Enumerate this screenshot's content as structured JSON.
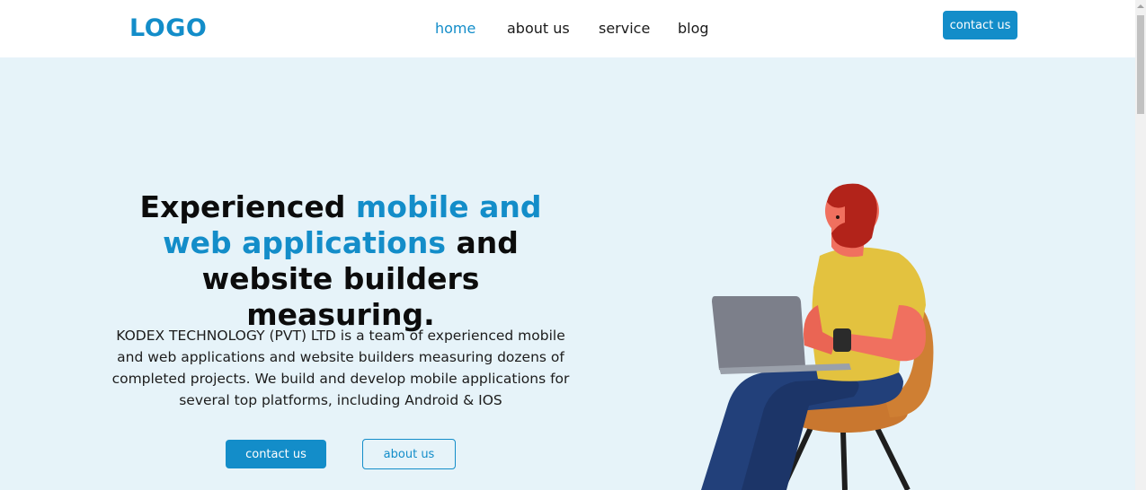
{
  "header": {
    "logo": "LOGO",
    "nav": [
      {
        "label": "home",
        "active": true
      },
      {
        "label": "about us",
        "active": false
      },
      {
        "label": "service",
        "active": false
      },
      {
        "label": "blog",
        "active": false
      }
    ],
    "cta_label": "contact us"
  },
  "hero": {
    "title_part1": "Experienced ",
    "title_accent": "mobile and web applications",
    "title_part2": " and website builders measuring.",
    "description": "KODEX TECHNOLOGY (PVT) LTD is a team of experienced mobile and web applications and website builders measuring dozens of completed projects. We build and develop mobile applications for several top platforms, including Android & IOS",
    "primary_button": "contact us",
    "secondary_button": "about us"
  },
  "colors": {
    "accent": "#138dc9",
    "hero_background": "#e6f3f9",
    "header_background": "#ffffff"
  }
}
